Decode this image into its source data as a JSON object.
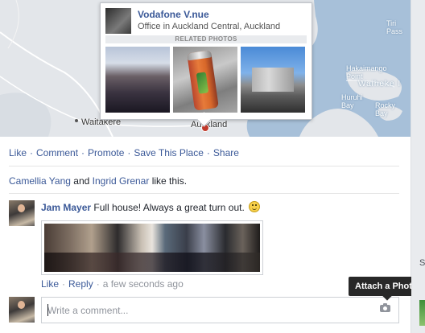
{
  "map": {
    "labels": {
      "waitakere": "Waitakere",
      "auckland": "Auckland",
      "hakaimango": "Hakaimango\nPoint",
      "waiheke": "Waiheke I",
      "huruhi": "Huruhi\nBay",
      "rocky": "Rocky\nBay",
      "tiri": "Tiri\nPass"
    },
    "colors": {
      "land": "#e3e6ea",
      "water": "#a7c0d9",
      "road": "#ffffff"
    }
  },
  "place_popup": {
    "name": "Vodafone V.nue",
    "subtitle": "Office in Auckland Central, Auckland",
    "related_label": "RELATED PHOTOS"
  },
  "actions": {
    "like": "Like",
    "comment": "Comment",
    "promote": "Promote",
    "save_place": "Save This Place",
    "share": "Share",
    "separator": "·"
  },
  "likes": {
    "user1": "Camellia Yang",
    "and": "and",
    "user2": "Ingrid Grenar",
    "suffix": "like this."
  },
  "comment": {
    "author": "Jam Mayer",
    "text": "Full house! Always a great turn out.",
    "like": "Like",
    "reply": "Reply",
    "time": "a few seconds ago",
    "separator": "·"
  },
  "reply_box": {
    "placeholder": "Write a comment...",
    "attach_tooltip": "Attach a Photo"
  },
  "sidebar": {
    "letter": "S"
  },
  "icons": [
    "place-thumbnail",
    "smiley-icon",
    "camera-icon",
    "map-pin-icon"
  ],
  "colors": {
    "link": "#3b5998",
    "muted": "#90949c",
    "tooltip_bg": "#282828"
  }
}
